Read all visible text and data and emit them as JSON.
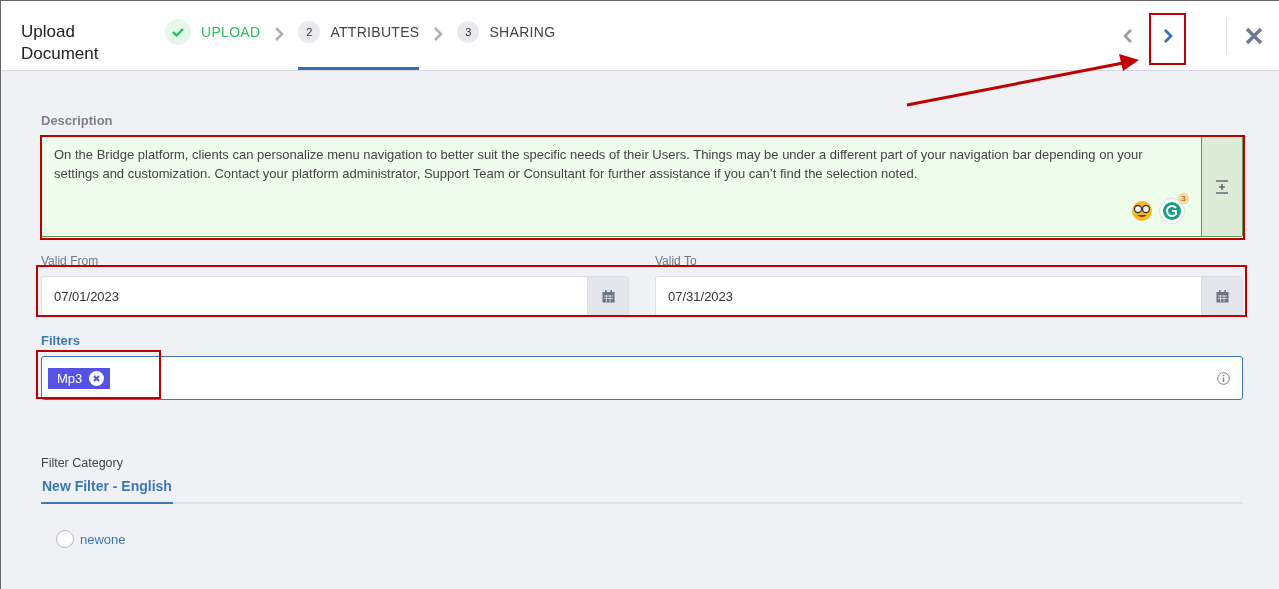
{
  "dialog": {
    "title": "Upload Document"
  },
  "steps": [
    {
      "kind": "done",
      "label": "UPLOAD",
      "selected": false
    },
    {
      "kind": "number",
      "number": "2",
      "label": "ATTRIBUTES",
      "selected": true
    },
    {
      "kind": "number",
      "number": "3",
      "label": "SHARING",
      "selected": false
    }
  ],
  "nav": {
    "prev_disabled": true
  },
  "description": {
    "label": "Description",
    "value": "On the Bridge platform, clients can personalize menu navigation to better suit the specific needs of their Users. Things may be under a different part of your navigation bar depending on your settings and customization. Contact your platform administrator, Support Team or Consultant for further assistance if you can’t find the selection noted.",
    "grammar_badge": "3"
  },
  "dates": [
    {
      "label": "Valid From",
      "value": "07/01/2023"
    },
    {
      "label": "Valid To",
      "value": "07/31/2023"
    }
  ],
  "filters": {
    "label": "Filters",
    "chips": [
      "Mp3"
    ]
  },
  "filter_category": {
    "label": "Filter Category",
    "tabs": [
      {
        "label": "New Filter - English",
        "selected": true
      }
    ],
    "options": [
      {
        "label": "newone",
        "checked": false
      }
    ]
  }
}
